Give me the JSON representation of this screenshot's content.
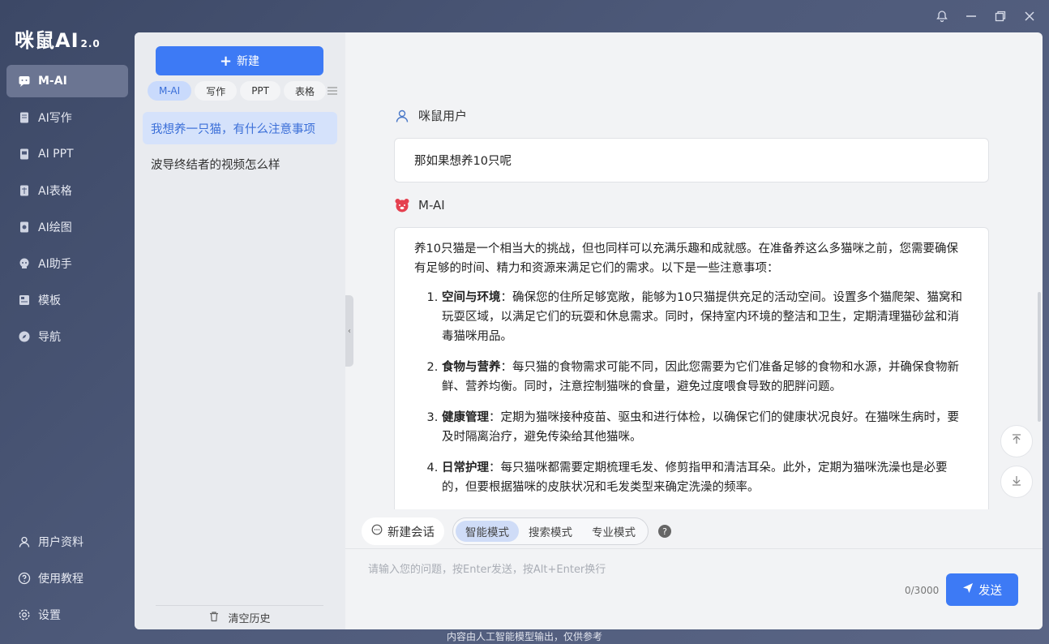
{
  "app": {
    "logo": "咪鼠AI",
    "version": "2.0"
  },
  "nav": {
    "items": [
      {
        "label": "M-AI",
        "icon": "chat-icon"
      },
      {
        "label": "AI写作",
        "icon": "document-icon"
      },
      {
        "label": "AI PPT",
        "icon": "presentation-icon"
      },
      {
        "label": "AI表格",
        "icon": "table-icon"
      },
      {
        "label": "AI绘图",
        "icon": "paint-icon"
      },
      {
        "label": "AI助手",
        "icon": "assistant-icon"
      },
      {
        "label": "模板",
        "icon": "template-icon"
      },
      {
        "label": "导航",
        "icon": "compass-icon"
      }
    ],
    "bottom": [
      {
        "label": "用户资料",
        "icon": "user-icon"
      },
      {
        "label": "使用教程",
        "icon": "help-icon"
      },
      {
        "label": "设置",
        "icon": "gear-icon"
      }
    ]
  },
  "history": {
    "new_label": "新建",
    "tabs": [
      "M-AI",
      "写作",
      "PPT",
      "表格"
    ],
    "items": [
      "我想养一只猫，有什么注意事项",
      "波导终结者的视频怎么样"
    ],
    "clear_label": "清空历史"
  },
  "chat": {
    "user_name": "咪鼠用户",
    "user_message": "那如果想养10只呢",
    "ai_name": "M-AI",
    "ai_intro": "养10只猫是一个相当大的挑战，但也同样可以充满乐趣和成就感。在准备养这么多猫咪之前，您需要确保有足够的时间、精力和资源来满足它们的需求。以下是一些注意事项：",
    "ai_points": [
      {
        "title": "空间与环境",
        "text": "：确保您的住所足够宽敞，能够为10只猫提供充足的活动空间。设置多个猫爬架、猫窝和玩耍区域，以满足它们的玩耍和休息需求。同时，保持室内环境的整洁和卫生，定期清理猫砂盆和消毒猫咪用品。"
      },
      {
        "title": "食物与营养",
        "text": "：每只猫的食物需求可能不同，因此您需要为它们准备足够的食物和水源，并确保食物新鲜、营养均衡。同时，注意控制猫咪的食量，避免过度喂食导致的肥胖问题。"
      },
      {
        "title": "健康管理",
        "text": "：定期为猫咪接种疫苗、驱虫和进行体检，以确保它们的健康状况良好。在猫咪生病时，要及时隔离治疗，避免传染给其他猫咪。"
      },
      {
        "title": "日常护理",
        "text": "：每只猫咪都需要定期梳理毛发、修剪指甲和清洁耳朵。此外，定期为猫咪洗澡也是必要的，但要根据猫咪的皮肤状况和毛发类型来确定洗澡的频率。"
      }
    ]
  },
  "toolbar": {
    "new_chat": "新建会话",
    "modes": [
      "智能模式",
      "搜索模式",
      "专业模式"
    ],
    "help": "?"
  },
  "input": {
    "placeholder": "请输入您的问题，按Enter发送，按Alt+Enter换行",
    "counter": "0/3000",
    "send_label": "发送"
  },
  "footer_note": "内容由人工智能模型输出，仅供参考",
  "colors": {
    "accent": "#3d7af5",
    "sidebar_bg": "#4a5574"
  }
}
